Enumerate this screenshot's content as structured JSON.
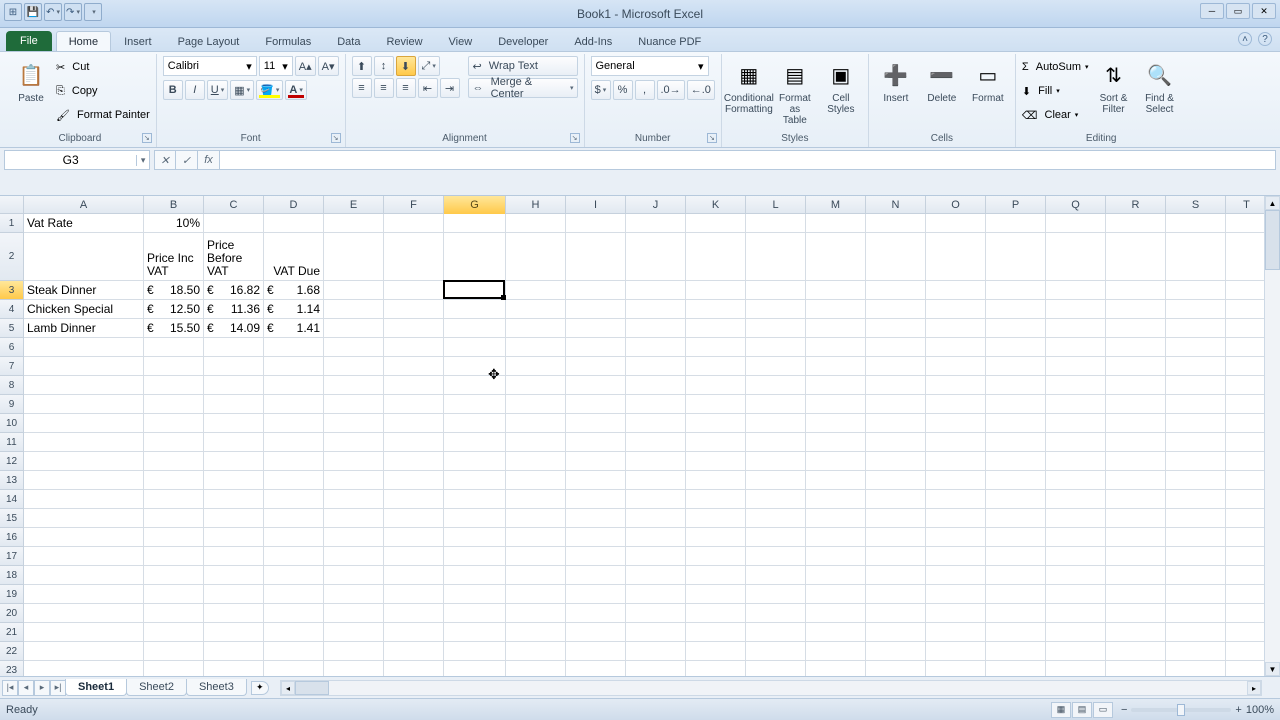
{
  "app": {
    "title": "Book1 - Microsoft Excel"
  },
  "tabs": {
    "file": "File",
    "list": [
      "Home",
      "Insert",
      "Page Layout",
      "Formulas",
      "Data",
      "Review",
      "View",
      "Developer",
      "Add-Ins",
      "Nuance PDF"
    ],
    "active": "Home"
  },
  "ribbon": {
    "clipboard": {
      "paste": "Paste",
      "cut": "Cut",
      "copy": "Copy",
      "formatPainter": "Format Painter",
      "label": "Clipboard"
    },
    "font": {
      "name": "Calibri",
      "size": "11",
      "label": "Font"
    },
    "alignment": {
      "wrap": "Wrap Text",
      "merge": "Merge & Center",
      "label": "Alignment"
    },
    "number": {
      "format": "General",
      "label": "Number"
    },
    "styles": {
      "cond": "Conditional Formatting",
      "fmtTable": "Format as Table",
      "cellStyles": "Cell Styles",
      "label": "Styles"
    },
    "cells": {
      "insert": "Insert",
      "delete": "Delete",
      "format": "Format",
      "label": "Cells"
    },
    "editing": {
      "autosum": "AutoSum",
      "fill": "Fill",
      "clear": "Clear",
      "sort": "Sort & Filter",
      "find": "Find & Select",
      "label": "Editing"
    }
  },
  "namebox": "G3",
  "columns": [
    "A",
    "B",
    "C",
    "D",
    "E",
    "F",
    "G",
    "H",
    "I",
    "J",
    "K",
    "L",
    "M",
    "N",
    "O",
    "P",
    "Q",
    "R",
    "S",
    "T"
  ],
  "selectedCol": "G",
  "selectedRow": 3,
  "headersRow2": {
    "B": "Price Inc VAT",
    "C": "Price Before VAT",
    "D": "VAT Due"
  },
  "data": {
    "r1": {
      "A": "Vat Rate",
      "B": "10%"
    },
    "r3": {
      "A": "Steak Dinner",
      "B_sym": "€",
      "B": "18.50",
      "C_sym": "€",
      "C": "16.82",
      "D_sym": "€",
      "D": "1.68"
    },
    "r4": {
      "A": "Chicken Special",
      "B_sym": "€",
      "B": "12.50",
      "C_sym": "€",
      "C": "11.36",
      "D_sym": "€",
      "D": "1.14"
    },
    "r5": {
      "A": "Lamb Dinner",
      "B_sym": "€",
      "B": "15.50",
      "C_sym": "€",
      "C": "14.09",
      "D_sym": "€",
      "D": "1.41"
    }
  },
  "sheets": {
    "list": [
      "Sheet1",
      "Sheet2",
      "Sheet3"
    ],
    "active": "Sheet1"
  },
  "status": {
    "ready": "Ready",
    "zoom": "100%"
  }
}
